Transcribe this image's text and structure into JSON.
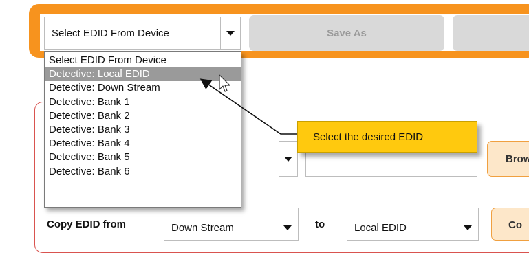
{
  "toolbar": {
    "selected_edid": "Select EDID From Device",
    "save_as_label": "Save As"
  },
  "dropdown": {
    "options": [
      "Select EDID From Device",
      "Detective: Local EDID",
      "Detective: Down Stream",
      "Detective: Bank 1",
      "Detective: Bank 2",
      "Detective: Bank 3",
      "Detective: Bank 4",
      "Detective: Bank 5",
      "Detective: Bank 6"
    ],
    "highlighted_index": 1
  },
  "panel": {
    "browse_label": "Brow",
    "copy_label": "Copy EDID from",
    "copy_from_value": "Down Stream",
    "to_label": "to",
    "copy_to_value": "Local EDID",
    "copy_button_label": "Co"
  },
  "callout": {
    "text": "Select the desired EDID"
  },
  "colors": {
    "toolbar_orange": "#f7931e",
    "callout_yellow": "#ffc90e",
    "panel_border_red": "#d9534f",
    "highlight_gray": "#9a9a9a"
  }
}
